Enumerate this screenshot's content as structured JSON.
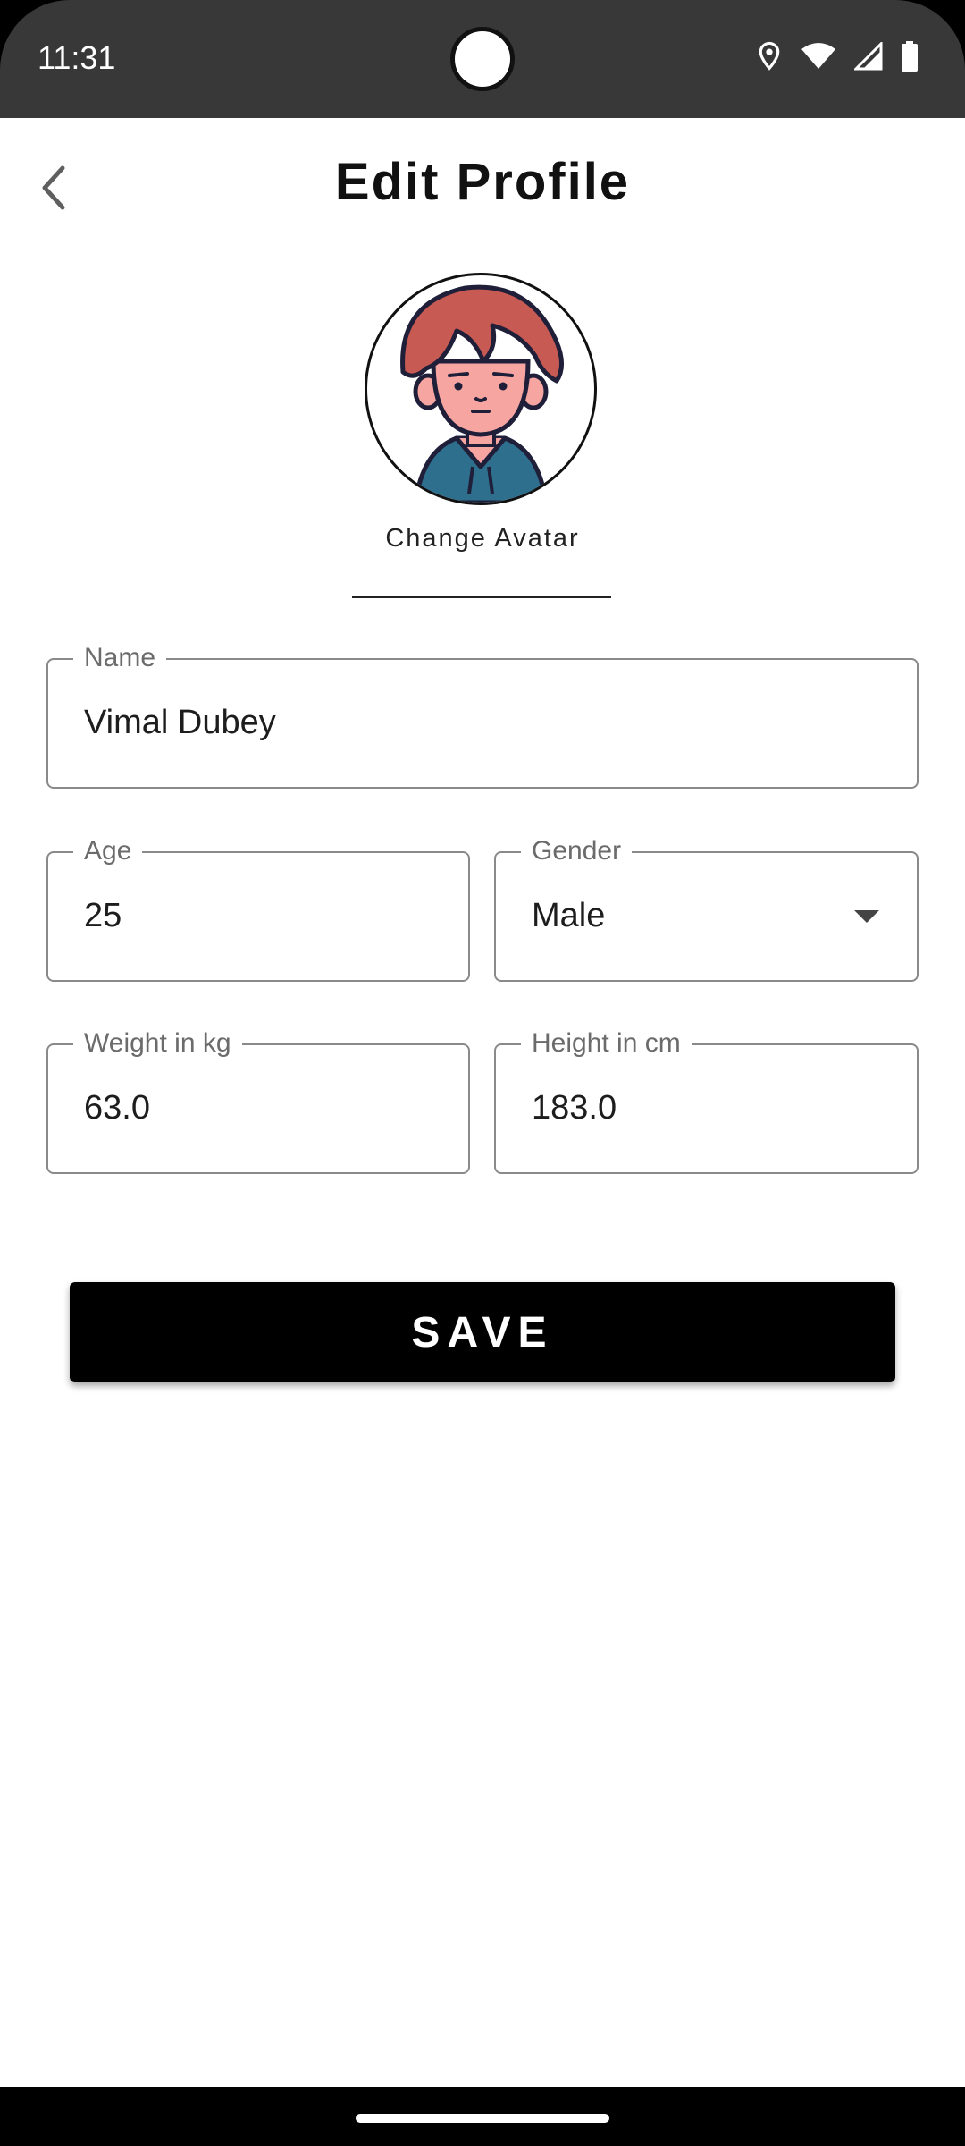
{
  "status_bar": {
    "time": "11:31",
    "icons": [
      "location-icon",
      "wifi-icon",
      "signal-icon",
      "battery-icon"
    ]
  },
  "header": {
    "title": "Edit Profile",
    "back_icon": "chevron-left-icon"
  },
  "avatar": {
    "change_label": "Change Avatar"
  },
  "form": {
    "name": {
      "label": "Name",
      "value": "Vimal Dubey"
    },
    "age": {
      "label": "Age",
      "value": "25"
    },
    "gender": {
      "label": "Gender",
      "value": "Male",
      "icon": "dropdown-arrow-icon"
    },
    "weight": {
      "label": "Weight in kg",
      "value": "63.0"
    },
    "height": {
      "label": "Height in cm",
      "value": "183.0"
    }
  },
  "actions": {
    "save_label": "SAVE"
  },
  "colors": {
    "status_bar": "#383838",
    "button": "#000000",
    "field_border": "#8a8a8a",
    "avatar_hair": "#c85a54",
    "avatar_skin": "#f7a5a0",
    "avatar_hoodie": "#2e6f8e"
  }
}
